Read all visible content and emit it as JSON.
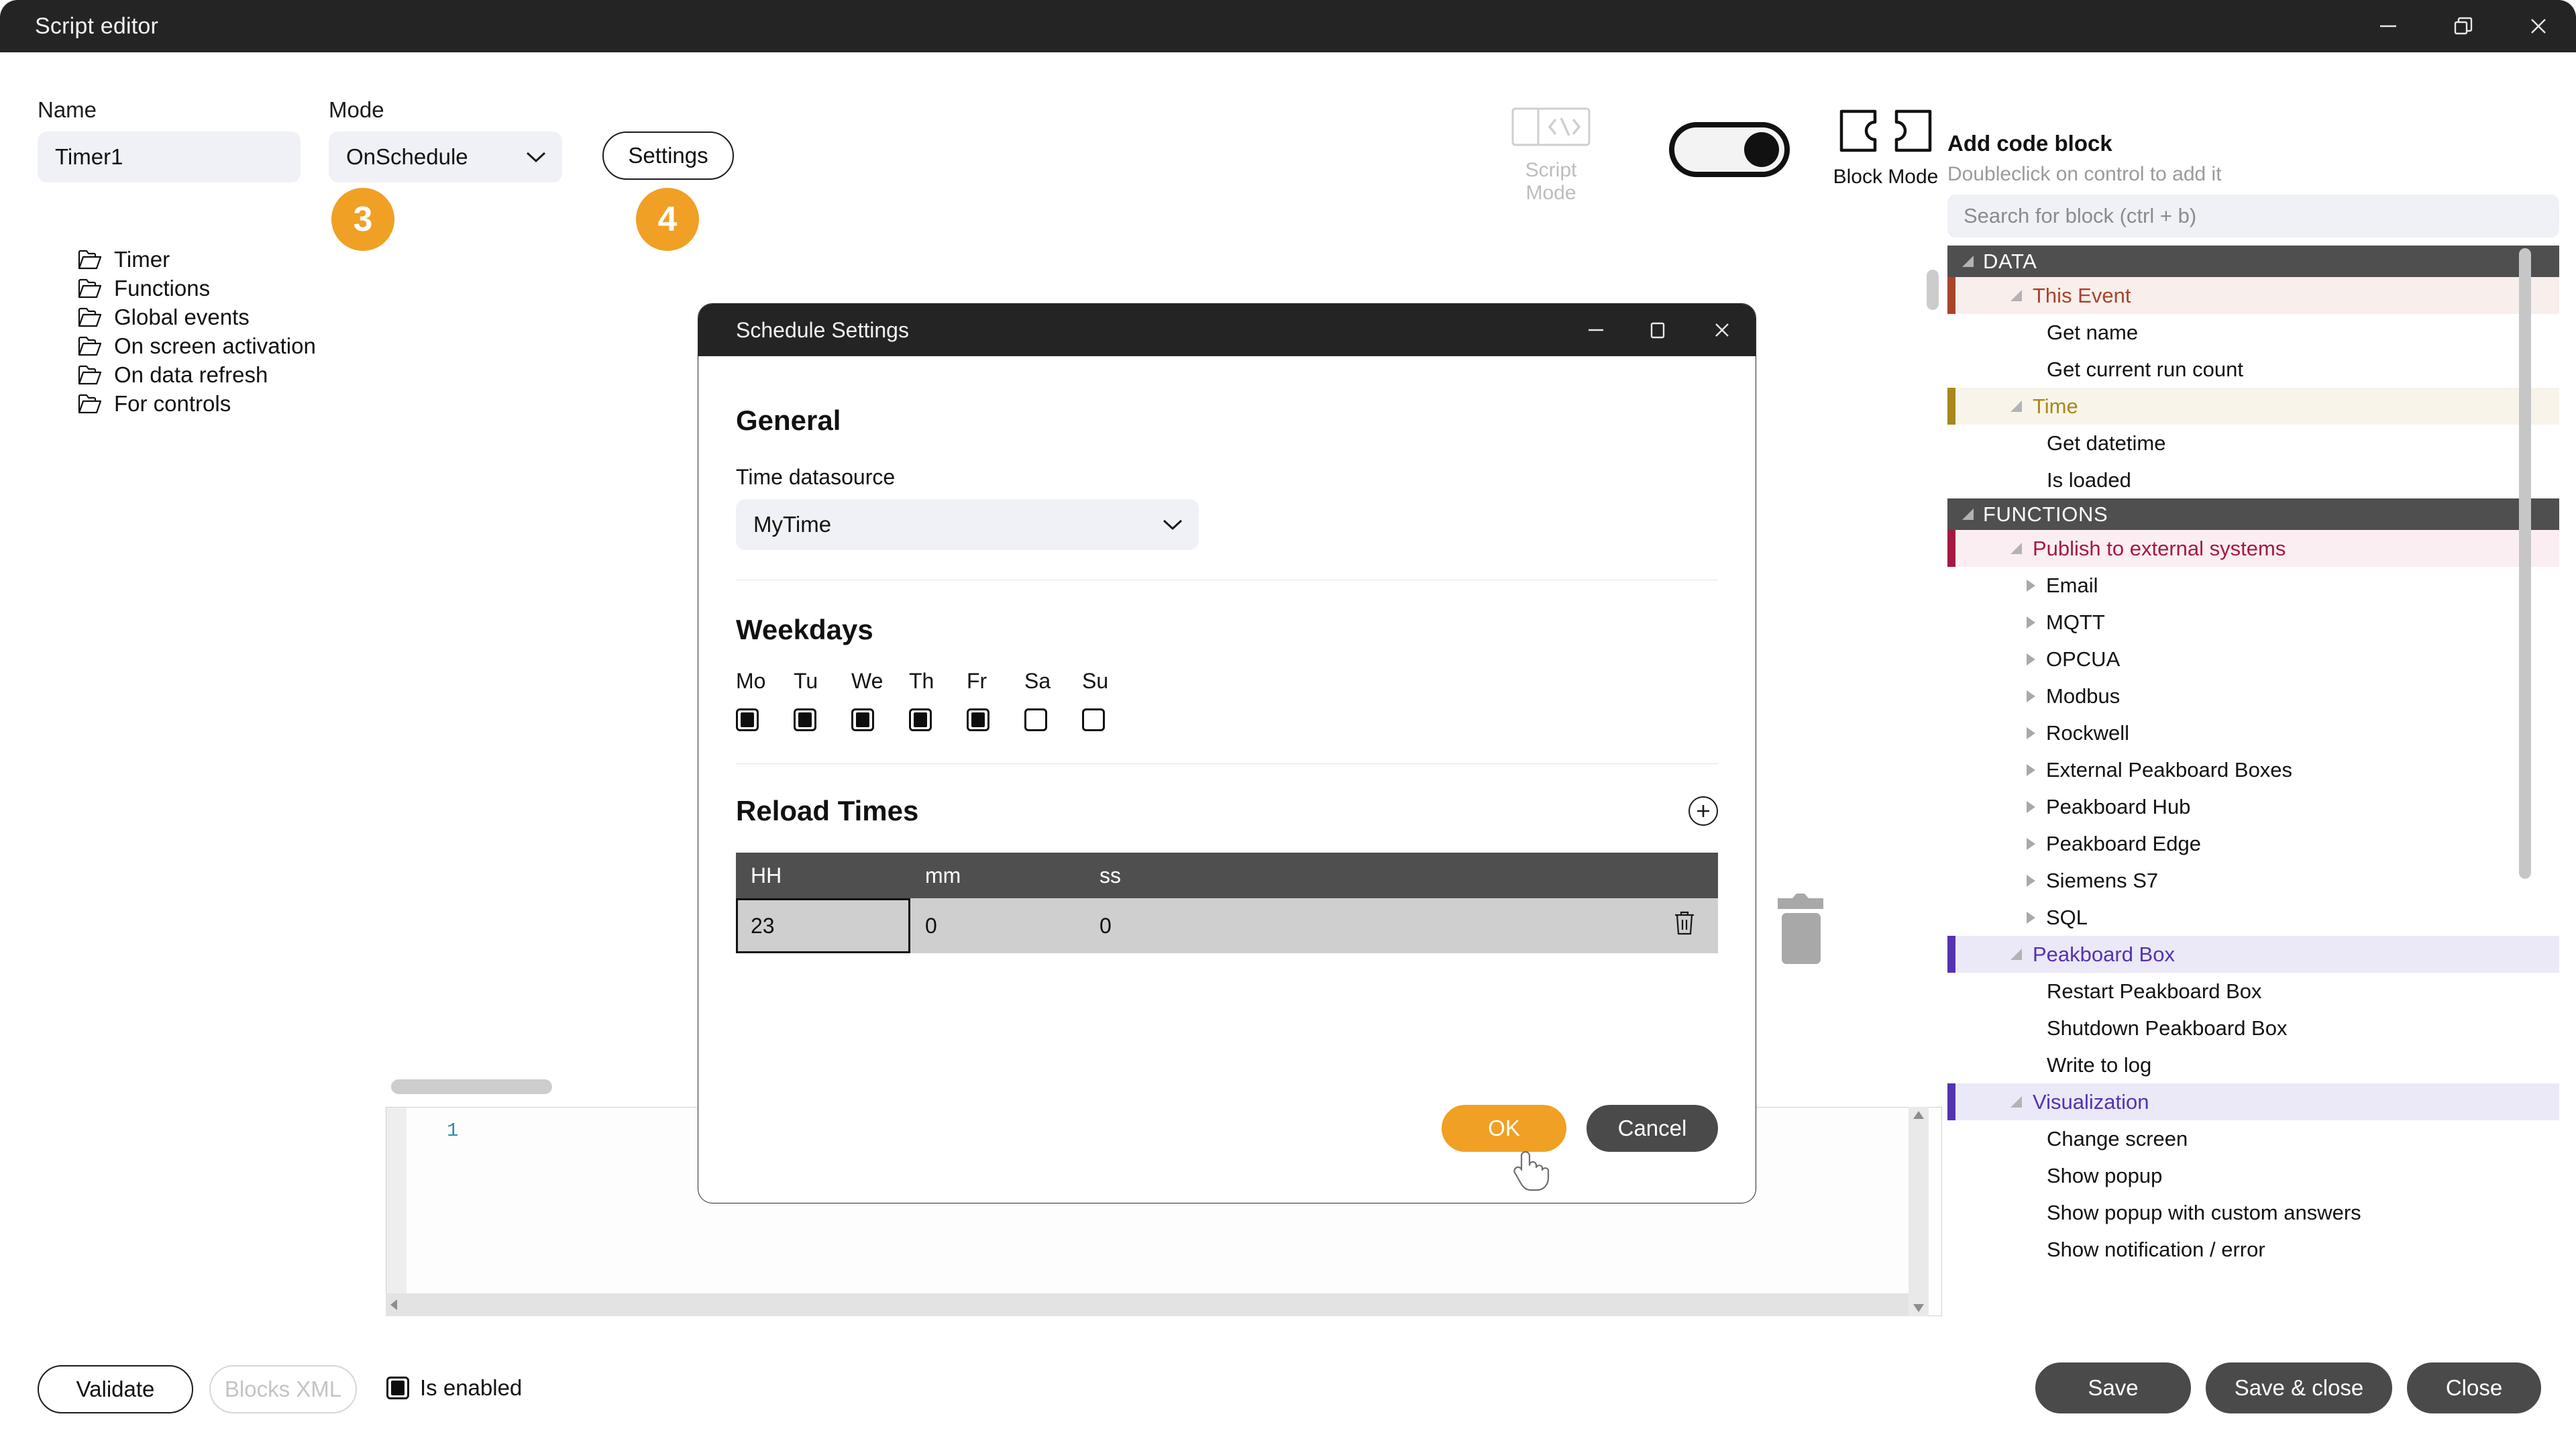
{
  "window": {
    "title": "Script editor",
    "controls": [
      {
        "name": "minimize",
        "glyph": "minimize-icon"
      },
      {
        "name": "restore",
        "glyph": "restore-icon"
      },
      {
        "name": "close",
        "glyph": "close-icon"
      }
    ]
  },
  "form": {
    "name_label": "Name",
    "name_value": "Timer1",
    "mode_label": "Mode",
    "mode_value": "OnSchedule",
    "settings_label": "Settings",
    "badge_mode": "3",
    "badge_settings": "4"
  },
  "tree_folders": [
    {
      "label": "Timer"
    },
    {
      "label": "Functions"
    },
    {
      "label": "Global events"
    },
    {
      "label": "On screen activation"
    },
    {
      "label": "On data refresh"
    },
    {
      "label": "For controls"
    }
  ],
  "mode_switch": {
    "script_label": "Script Mode",
    "block_label": "Block Mode",
    "active": "Block Mode"
  },
  "blocks_panel": {
    "title": "Add code block",
    "subtitle": "Doubleclick on control to add it",
    "search_placeholder": "Search for block (ctrl + b)",
    "sections": [
      {
        "label": "DATA",
        "groups": [
          {
            "label": "This Event",
            "color": "#a8442a",
            "bg": "#f8eeeb",
            "text": "#a8442a",
            "items": [
              {
                "label": "Get name",
                "expandable": false
              },
              {
                "label": "Get current run count",
                "expandable": false
              }
            ]
          },
          {
            "label": "Time",
            "color": "#a8881a",
            "bg": "#f8f4e9",
            "text": "#a8881a",
            "items": [
              {
                "label": "Get datetime",
                "expandable": false
              },
              {
                "label": "Is loaded",
                "expandable": false
              }
            ]
          }
        ]
      },
      {
        "label": "FUNCTIONS",
        "groups": [
          {
            "label": "Publish to external systems",
            "color": "#a51843",
            "bg": "#fbeef2",
            "text": "#a51843",
            "items": [
              {
                "label": "Email",
                "expandable": true
              },
              {
                "label": "MQTT",
                "expandable": true
              },
              {
                "label": "OPCUA",
                "expandable": true
              },
              {
                "label": "Modbus",
                "expandable": true
              },
              {
                "label": "Rockwell",
                "expandable": true
              },
              {
                "label": "External Peakboard Boxes",
                "expandable": true
              },
              {
                "label": "Peakboard Hub",
                "expandable": true
              },
              {
                "label": "Peakboard Edge",
                "expandable": true
              },
              {
                "label": "Siemens S7",
                "expandable": true
              },
              {
                "label": "SQL",
                "expandable": true
              }
            ]
          },
          {
            "label": "Peakboard Box",
            "color": "#5433b0",
            "bg": "#ebe8f7",
            "text": "#5433b0",
            "items": [
              {
                "label": "Restart Peakboard Box",
                "expandable": false
              },
              {
                "label": "Shutdown Peakboard Box",
                "expandable": false
              },
              {
                "label": "Write to log",
                "expandable": false
              }
            ]
          },
          {
            "label": "Visualization",
            "color": "#5433b0",
            "bg": "#ebe8f7",
            "text": "#5433b0",
            "items": [
              {
                "label": "Change screen",
                "expandable": false
              },
              {
                "label": "Show popup",
                "expandable": false
              },
              {
                "label": "Show popup with custom answers",
                "expandable": false
              },
              {
                "label": "Show notification / error",
                "expandable": false
              }
            ]
          }
        ]
      }
    ]
  },
  "editor": {
    "line_number": "1"
  },
  "footer": {
    "validate_label": "Validate",
    "blocks_xml_label": "Blocks XML",
    "is_enabled_label": "Is enabled",
    "is_enabled_checked": true,
    "save_label": "Save",
    "save_close_label": "Save & close",
    "close_label": "Close"
  },
  "dialog": {
    "title": "Schedule Settings",
    "general_heading": "General",
    "time_datasource_label": "Time datasource",
    "time_datasource_value": "MyTime",
    "weekdays_heading": "Weekdays",
    "weekdays": [
      {
        "label": "Mo",
        "checked": true
      },
      {
        "label": "Tu",
        "checked": true
      },
      {
        "label": "We",
        "checked": true
      },
      {
        "label": "Th",
        "checked": true
      },
      {
        "label": "Fr",
        "checked": true
      },
      {
        "label": "Sa",
        "checked": false
      },
      {
        "label": "Su",
        "checked": false
      }
    ],
    "reload_heading": "Reload Times",
    "table_headers": [
      "HH",
      "mm",
      "ss"
    ],
    "table_rows": [
      {
        "HH": "23",
        "mm": "0",
        "ss": "0"
      }
    ],
    "ok_label": "OK",
    "cancel_label": "Cancel"
  },
  "colors": {
    "accent": "#f0a024",
    "dark": "#242424",
    "panel_header": "#4f4f4f",
    "field_bg": "#eff1f6"
  }
}
